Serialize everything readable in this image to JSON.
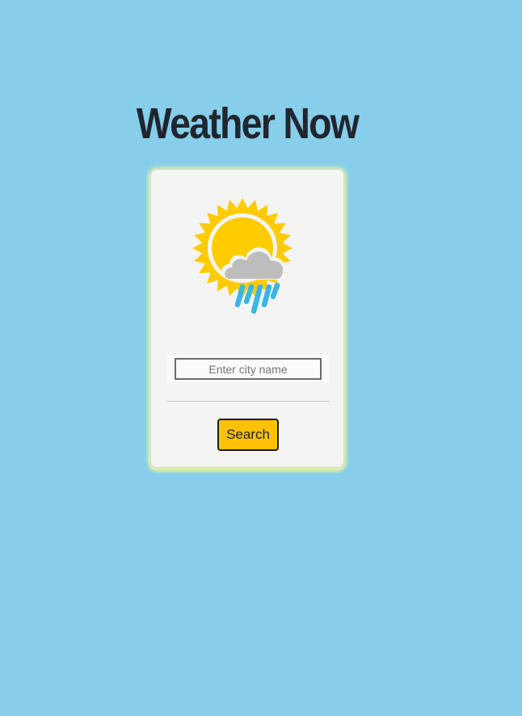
{
  "header": {
    "title": "Weather Now"
  },
  "card": {
    "icon": "sun-cloud-rain-icon",
    "search": {
      "placeholder": "Enter city name",
      "value": ""
    },
    "button_label": "Search"
  },
  "colors": {
    "background": "#87ceeb",
    "card": "#f4f4f4",
    "button": "#ffc107",
    "sun": "#ffcc00",
    "cloud": "#bdbdbd",
    "rain": "#3bb5e6",
    "title": "#1f262e"
  }
}
